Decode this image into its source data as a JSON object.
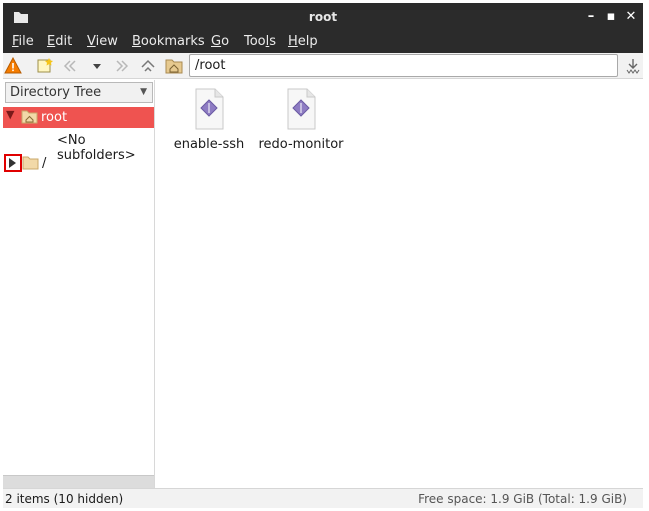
{
  "window": {
    "title": "root",
    "controls": [
      "minimize",
      "maximize",
      "close"
    ]
  },
  "menubar": {
    "items": [
      {
        "label": "File",
        "mnemonic": "F"
      },
      {
        "label": "Edit",
        "mnemonic": "E"
      },
      {
        "label": "View",
        "mnemonic": "V"
      },
      {
        "label": "Bookmarks",
        "mnemonic": "B"
      },
      {
        "label": "Go",
        "mnemonic": "G"
      },
      {
        "label": "Tools",
        "mnemonic": "l"
      },
      {
        "label": "Help",
        "mnemonic": "H"
      }
    ]
  },
  "toolbar": {
    "icons": [
      "warning-icon",
      "new-tab-icon",
      "back-icon",
      "history-dropdown-icon",
      "forward-icon",
      "up-icon",
      "home-folder-icon",
      "go-icon"
    ],
    "location_value": "/root"
  },
  "sidebar": {
    "mode_label": "Directory Tree",
    "tree": {
      "root_label": "root",
      "no_subfolders_label": "<No subfolders>",
      "filesystem_label": "/"
    }
  },
  "files": [
    {
      "name": "enable-ssh",
      "icon": "executable-script-icon"
    },
    {
      "name": "redo-monitor",
      "icon": "executable-script-icon"
    }
  ],
  "statusbar": {
    "items_text": "2 items (10 hidden)",
    "free_space_text": "Free space: 1.9 GiB (Total: 1.9 GiB)"
  },
  "colors": {
    "titlebar_bg": "#2b2b2b",
    "selection_bg": "#ef5350",
    "highlight_box": "#e00000"
  }
}
